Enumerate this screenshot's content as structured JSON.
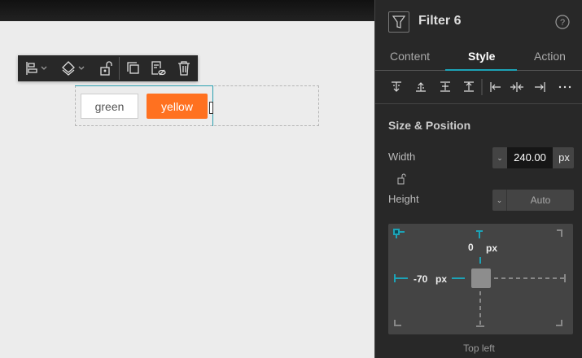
{
  "canvas": {
    "buttons": [
      {
        "label": "green"
      },
      {
        "label": "yellow",
        "color": "#ff7120"
      }
    ]
  },
  "panel": {
    "title": "Filter 6",
    "tabs": [
      {
        "label": "Content"
      },
      {
        "label": "Style",
        "active": true
      },
      {
        "label": "Action"
      }
    ],
    "section_title": "Size & Position",
    "width": {
      "label": "Width",
      "value": "240.00",
      "unit": "px"
    },
    "height": {
      "label": "Height",
      "value": "Auto"
    },
    "position": {
      "top": "0",
      "top_unit": "px",
      "left": "-70",
      "left_unit": "px",
      "anchor_label": "Top left"
    },
    "accent": "#1ca3b7"
  }
}
